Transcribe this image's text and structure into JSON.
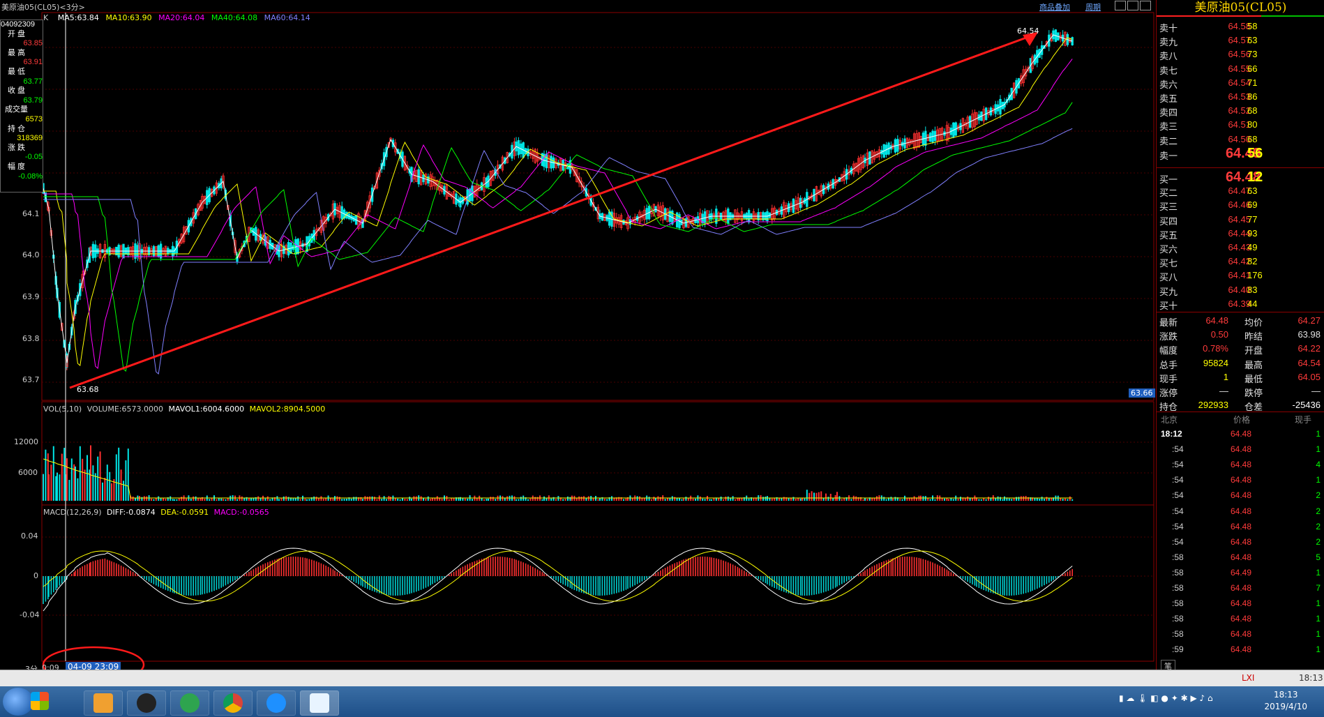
{
  "window": {
    "symbol_title": "美原油05(CL05)<3分>",
    "link_overlay": "商品叠加",
    "link_period": "周期"
  },
  "price_panel": {
    "k_label": "K",
    "ma_legend": [
      {
        "text": "MA5:63.84",
        "color": "#ffffff"
      },
      {
        "text": "MA10:63.90",
        "color": "#ffff00"
      },
      {
        "text": "MA20:64.04",
        "color": "#ff00ff"
      },
      {
        "text": "MA40:64.08",
        "color": "#00ff00"
      },
      {
        "text": "MA60:64.14",
        "color": "#8080ff"
      }
    ],
    "y_ticks": [
      "64.1",
      "64.0",
      "63.9",
      "63.8",
      "63.7"
    ],
    "high_marker": "64.54",
    "low_marker": "63.68",
    "current_price_tag": "63.66"
  },
  "info_box": {
    "time": "04092309",
    "rows": [
      {
        "label": "开 盘",
        "value": "63.85",
        "color": "#ff3b3b"
      },
      {
        "label": "最 高",
        "value": "63.91",
        "color": "#ff3b3b"
      },
      {
        "label": "最 低",
        "value": "63.77",
        "color": "#00ff00"
      },
      {
        "label": "收 盘",
        "value": "63.79",
        "color": "#00ff00"
      },
      {
        "label": "成交量",
        "value": "6573",
        "color": "#ffff00"
      },
      {
        "label": "持 仓",
        "value": "318369",
        "color": "#ffff00"
      },
      {
        "label": "涨 跌",
        "value": "-0.05",
        "color": "#00ff00"
      },
      {
        "label": "幅 度",
        "value": "-0.08%",
        "color": "#00ff00"
      }
    ]
  },
  "volume_panel": {
    "legend": [
      {
        "text": "VOL(5,10)",
        "color": "#cccccc"
      },
      {
        "text": "VOLUME:6573.0000",
        "color": "#cccccc"
      },
      {
        "text": "MAVOL1:6004.6000",
        "color": "#ffffff"
      },
      {
        "text": "MAVOL2:8904.5000",
        "color": "#ffff00"
      }
    ],
    "y_ticks": [
      "12000",
      "6000"
    ]
  },
  "macd_panel": {
    "legend": [
      {
        "text": "MACD(12,26,9)",
        "color": "#cccccc"
      },
      {
        "text": "DIFF:-0.0874",
        "color": "#ffffff"
      },
      {
        "text": "DEA:-0.0591",
        "color": "#ffff00"
      },
      {
        "text": "MACD:-0.0565",
        "color": "#ff00ff"
      }
    ],
    "y_ticks": [
      "0.04",
      "0",
      "-0.04"
    ]
  },
  "x_axis": {
    "period": "3分",
    "first_tick": "0:09",
    "cursor_time": "04-09 23:09"
  },
  "quote_panel": {
    "title": "美原油05(CL05)",
    "asks": [
      {
        "label": "卖十",
        "price": "64.58",
        "qty": "58"
      },
      {
        "label": "卖九",
        "price": "64.57",
        "qty": "63"
      },
      {
        "label": "卖八",
        "price": "64.56",
        "qty": "73"
      },
      {
        "label": "卖七",
        "price": "64.55",
        "qty": "66"
      },
      {
        "label": "卖六",
        "price": "64.54",
        "qty": "71"
      },
      {
        "label": "卖五",
        "price": "64.53",
        "qty": "86"
      },
      {
        "label": "卖四",
        "price": "64.52",
        "qty": "68"
      },
      {
        "label": "卖三",
        "price": "64.51",
        "qty": "80"
      },
      {
        "label": "卖二",
        "price": "64.50",
        "qty": "68"
      },
      {
        "label": "卖一",
        "price": "64.49",
        "qty": "56"
      }
    ],
    "bids": [
      {
        "label": "买一",
        "price": "64.48",
        "qty": "12"
      },
      {
        "label": "买二",
        "price": "64.47",
        "qty": "63"
      },
      {
        "label": "买三",
        "price": "64.46",
        "qty": "69"
      },
      {
        "label": "买四",
        "price": "64.45",
        "qty": "77"
      },
      {
        "label": "买五",
        "price": "64.44",
        "qty": "93"
      },
      {
        "label": "买六",
        "price": "64.43",
        "qty": "49"
      },
      {
        "label": "买七",
        "price": "64.42",
        "qty": "82"
      },
      {
        "label": "买八",
        "price": "64.41",
        "qty": "176"
      },
      {
        "label": "买九",
        "price": "64.40",
        "qty": "83"
      },
      {
        "label": "买十",
        "price": "64.39",
        "qty": "44"
      }
    ],
    "stats": [
      {
        "l1": "最新",
        "v1": "64.48",
        "c1": "#ff3b3b",
        "l2": "均价",
        "v2": "64.27",
        "c2": "#ff3b3b"
      },
      {
        "l1": "涨跌",
        "v1": "0.50",
        "c1": "#ff3b3b",
        "l2": "昨结",
        "v2": "63.98",
        "c2": "#e0e0e0"
      },
      {
        "l1": "幅度",
        "v1": "0.78%",
        "c1": "#ff3b3b",
        "l2": "开盘",
        "v2": "64.22",
        "c2": "#ff3b3b"
      },
      {
        "l1": "总手",
        "v1": "95824",
        "c1": "#ffff00",
        "l2": "最高",
        "v2": "64.54",
        "c2": "#ff3b3b"
      },
      {
        "l1": "现手",
        "v1": "1",
        "c1": "#ffff00",
        "l2": "最低",
        "v2": "64.05",
        "c2": "#ff3b3b"
      },
      {
        "l1": "涨停",
        "v1": "—",
        "c1": "#e0e0e0",
        "l2": "跌停",
        "v2": "—",
        "c2": "#e0e0e0"
      },
      {
        "l1": "持仓",
        "v1": "292933",
        "c1": "#ffff00",
        "l2": "仓差",
        "v2": "-25436",
        "c2": "#ffffff"
      }
    ],
    "trades_header": {
      "time": "北京",
      "price": "价格",
      "qty": "现手"
    },
    "trades": [
      {
        "time": "18:12",
        "price": "64.48",
        "qty": "1"
      },
      {
        "time": ":54",
        "price": "64.48",
        "qty": "1"
      },
      {
        "time": ":54",
        "price": "64.48",
        "qty": "4"
      },
      {
        "time": ":54",
        "price": "64.48",
        "qty": "1"
      },
      {
        "time": ":54",
        "price": "64.48",
        "qty": "2"
      },
      {
        "time": ":54",
        "price": "64.48",
        "qty": "2"
      },
      {
        "time": ":54",
        "price": "64.48",
        "qty": "2"
      },
      {
        "time": ":54",
        "price": "64.48",
        "qty": "2"
      },
      {
        "time": ":58",
        "price": "64.48",
        "qty": "5"
      },
      {
        "time": ":58",
        "price": "64.49",
        "qty": "1"
      },
      {
        "time": ":58",
        "price": "64.48",
        "qty": "7"
      },
      {
        "time": ":58",
        "price": "64.48",
        "qty": "1"
      },
      {
        "time": ":58",
        "price": "64.48",
        "qty": "1"
      },
      {
        "time": ":58",
        "price": "64.48",
        "qty": "1"
      },
      {
        "time": ":59",
        "price": "64.48",
        "qty": "1"
      }
    ],
    "bottom_tab": "笔"
  },
  "status_strip": {
    "right_text": "18:13"
  },
  "taskbar": {
    "clock_time": "18:13",
    "clock_date": "2019/4/10"
  }
}
